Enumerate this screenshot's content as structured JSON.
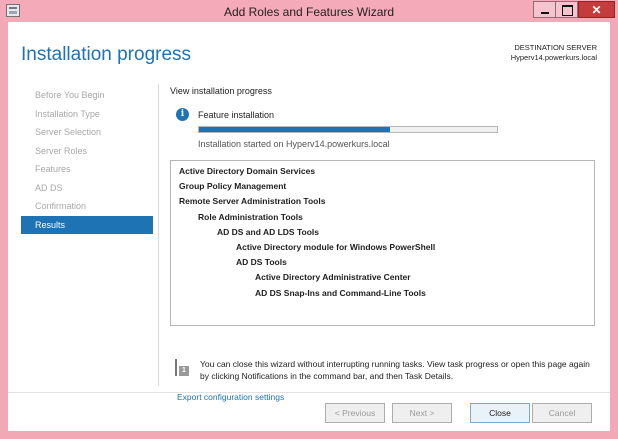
{
  "window": {
    "title": "Add Roles and Features Wizard",
    "close_glyph": "✕"
  },
  "header": {
    "page_title": "Installation progress",
    "destination_label": "DESTINATION SERVER",
    "destination_server": "Hyperv14.powerkurs.local"
  },
  "nav": {
    "items": [
      {
        "label": "Before You Begin"
      },
      {
        "label": "Installation Type"
      },
      {
        "label": "Server Selection"
      },
      {
        "label": "Server Roles"
      },
      {
        "label": "Features"
      },
      {
        "label": "AD DS"
      },
      {
        "label": "Confirmation"
      },
      {
        "label": "Results"
      }
    ],
    "active_index": 7
  },
  "main": {
    "section_title": "View installation progress",
    "info_glyph": "i",
    "feature_label": "Feature installation",
    "progress_fraction": 0.64,
    "status_text": "Installation started on Hyperv14.powerkurs.local",
    "results": [
      {
        "text": "Active Directory Domain Services",
        "level": 0
      },
      {
        "text": "Group Policy Management",
        "level": 0
      },
      {
        "text": "Remote Server Administration Tools",
        "level": 0
      },
      {
        "text": "Role Administration Tools",
        "level": 1
      },
      {
        "text": "AD DS and AD LDS Tools",
        "level": 2
      },
      {
        "text": "Active Directory module for Windows PowerShell",
        "level": 3
      },
      {
        "text": "AD DS Tools",
        "level": 3
      },
      {
        "text": "Active Directory Administrative Center",
        "level": 4
      },
      {
        "text": "AD DS Snap-Ins and Command-Line Tools",
        "level": 4
      }
    ],
    "notice_badge": "1",
    "notice_text": "You can close this wizard without interrupting running tasks. View task progress or open this page again by clicking Notifications in the command bar, and then Task Details.",
    "export_link": "Export configuration settings"
  },
  "footer": {
    "previous": "< Previous",
    "next": "Next >",
    "close": "Close",
    "cancel": "Cancel"
  },
  "colors": {
    "accent": "#1e73b4",
    "titlebar": "#f4aab8",
    "close_button": "#c43c3c"
  }
}
